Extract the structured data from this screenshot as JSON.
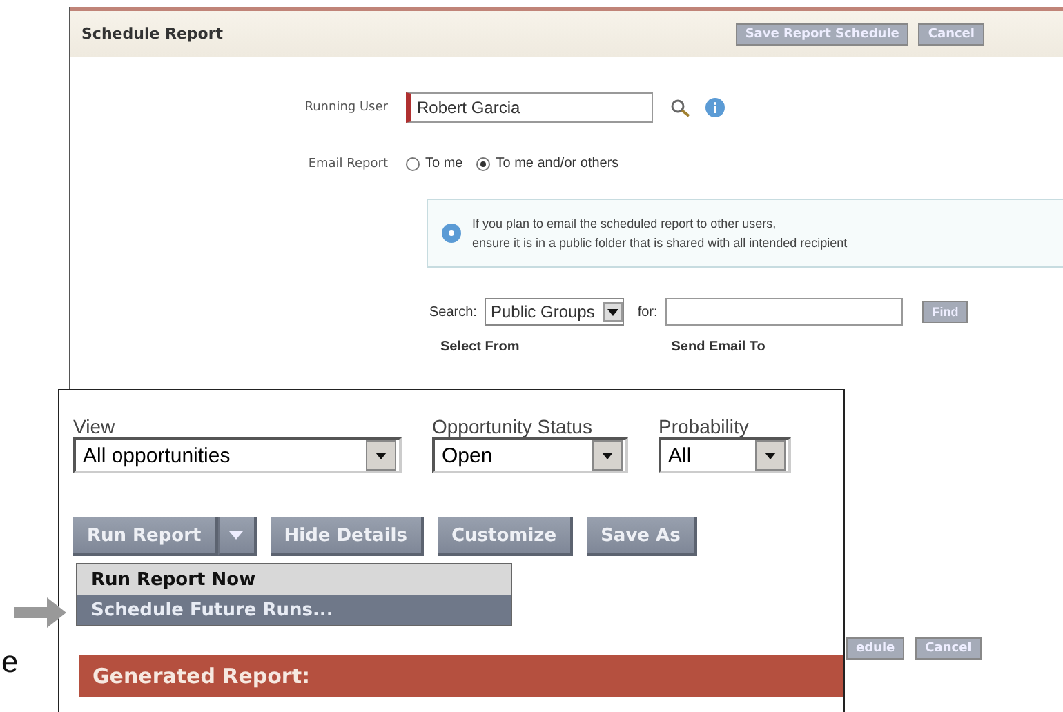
{
  "schedule_report": {
    "title": "Schedule Report",
    "header_buttons": [
      "Save Report Schedule",
      "Cancel"
    ],
    "running_user": {
      "label": "Running User",
      "value": "Robert Garcia"
    },
    "email_report": {
      "label": "Email Report",
      "options": [
        {
          "label": "To me",
          "selected": false
        },
        {
          "label": "To me and/or others",
          "selected": true
        }
      ]
    },
    "info_message": [
      "If you plan to email the scheduled report to other users,",
      "ensure it is in a public folder that is shared with all intended recipient"
    ],
    "search": {
      "label": "Search:",
      "scope": "Public Groups",
      "for_label": "for:",
      "button": "Find"
    },
    "columns": [
      "Select From",
      "Send Email To"
    ],
    "footer_buttons": [
      "edule",
      "Cancel"
    ]
  },
  "report_panel": {
    "filters": [
      {
        "label": "View",
        "value": "All opportunities"
      },
      {
        "label": "Opportunity Status",
        "value": "Open"
      },
      {
        "label": "Probability",
        "value": "All"
      }
    ],
    "buttons": [
      "Run Report",
      "Hide Details",
      "Customize",
      "Save As"
    ],
    "run_menu": [
      {
        "label": "Run Report Now",
        "selected": false
      },
      {
        "label": "Schedule Future Runs...",
        "selected": true
      }
    ],
    "section_title": "Generated Report:"
  },
  "side_text": "e"
}
